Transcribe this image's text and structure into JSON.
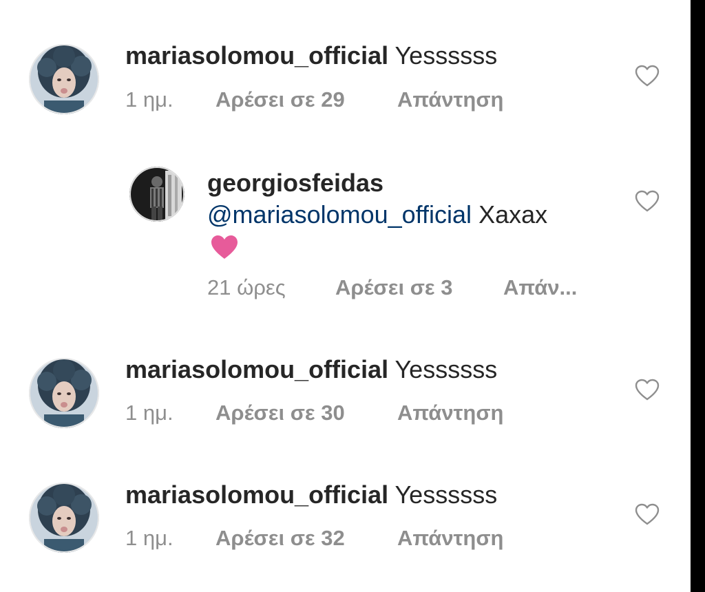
{
  "comments": [
    {
      "username": "mariasolomou_official",
      "text": "Yessssss",
      "time": "1 ημ.",
      "likes": "Αρέσει σε 29",
      "reply": "Απάντηση"
    },
    {
      "username": "georgiosfeidas",
      "mention": "@mariasolomou_official",
      "text": "Xaxax",
      "emoji": "heart-emoji",
      "time": "21 ώρες",
      "likes": "Αρέσει σε 3",
      "reply": "Απάν..."
    },
    {
      "username": "mariasolomou_official",
      "text": "Yessssss",
      "time": "1 ημ.",
      "likes": "Αρέσει σε 30",
      "reply": "Απάντηση"
    },
    {
      "username": "mariasolomou_official",
      "text": "Yessssss",
      "time": "1 ημ.",
      "likes": "Αρέσει σε 32",
      "reply": "Απάντηση"
    }
  ],
  "colors": {
    "text": "#262626",
    "meta": "#8e8e8e",
    "mention": "#003569",
    "emoji_heart": "#e75b9a",
    "heart_outline": "#8e8e8e"
  },
  "icons": {
    "like": "heart-outline-icon",
    "emoji": "pink-heart-emoji"
  }
}
